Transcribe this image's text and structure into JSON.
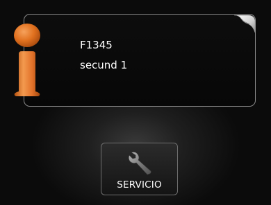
{
  "info_panel": {
    "code": "F1345",
    "message": "secund 1"
  },
  "service_button": {
    "label": "SERVICIO",
    "icon": "wrench-icon"
  },
  "icons": {
    "info": "info-icon",
    "page_curl": "page-curl-icon"
  },
  "colors": {
    "background": "#0b0b0b",
    "panel_border": "#8a8a8a",
    "info_icon_orange": "#e2722a",
    "text": "#ffffff"
  }
}
